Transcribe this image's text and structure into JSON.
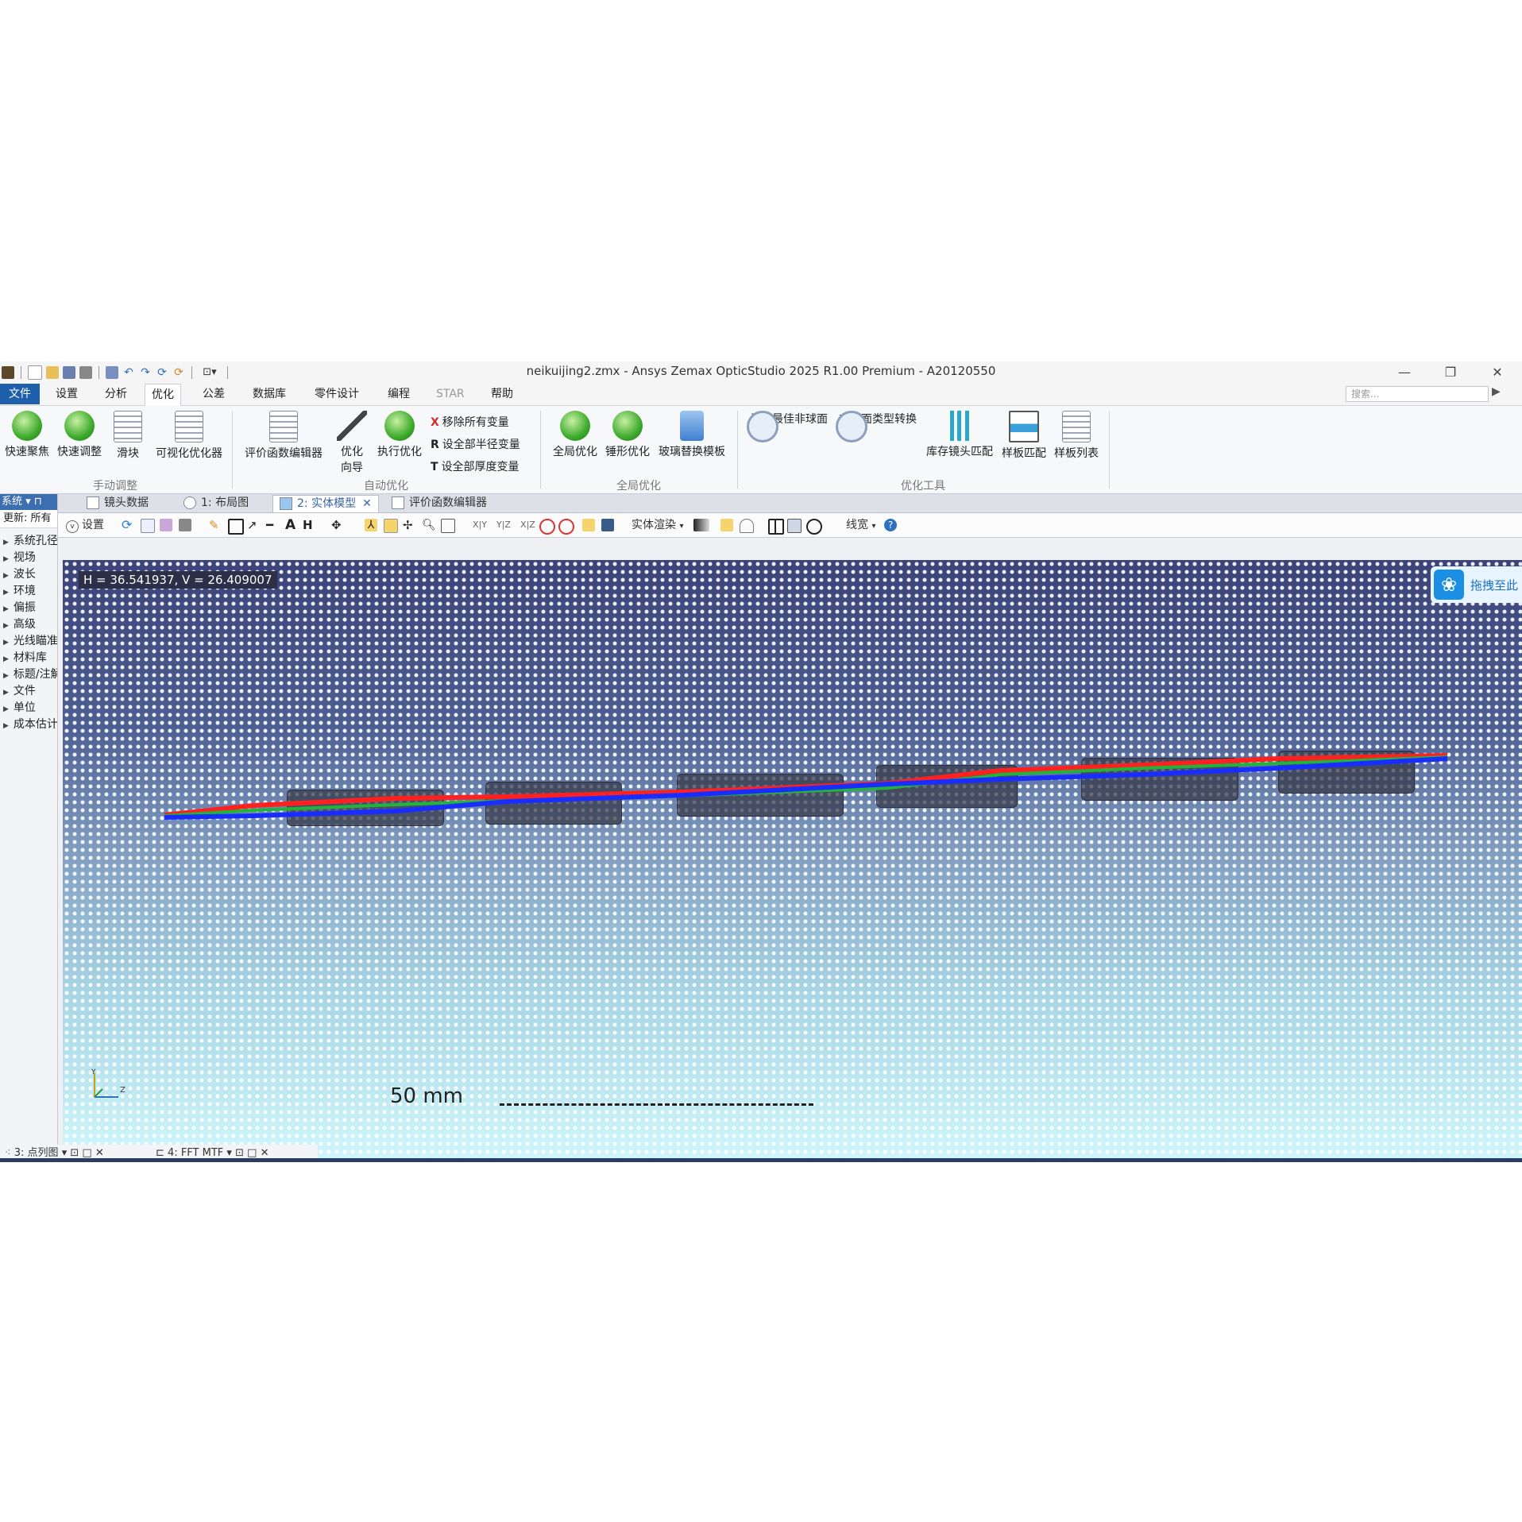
{
  "window": {
    "title": "neikuijing2.zmx - Ansys Zemax OpticStudio 2025 R1.00   Premium - A20120550",
    "minimize": "—",
    "restore": "❐",
    "close": "✕"
  },
  "menu": {
    "items": [
      "文件",
      "设置",
      "分析",
      "优化",
      "公差",
      "数据库",
      "零件设计",
      "编程",
      "STAR",
      "帮助"
    ],
    "active": "优化",
    "search_placeholder": "搜索..."
  },
  "ribbon": {
    "manual": {
      "group": "手动调整",
      "buttons": [
        "快速聚焦",
        "快速调整",
        "滑块",
        "可视化优化器"
      ]
    },
    "auto": {
      "group": "自动优化",
      "buttons": [
        "评价函数编辑器",
        "优化向导",
        "执行优化"
      ],
      "wizard_line1": "优化",
      "wizard_line2": "向导",
      "small": [
        {
          "sym": "X",
          "label": "移除所有变量"
        },
        {
          "sym": "R",
          "label": "设全部半径变量"
        },
        {
          "sym": "T",
          "label": "设全部厚度变量"
        }
      ]
    },
    "global": {
      "group": "全局优化",
      "buttons": [
        "全局优化",
        "锤形优化",
        "玻璃替换模板"
      ]
    },
    "tools": {
      "group": "优化工具",
      "buttons": [
        "寻找最佳非球面",
        "非球面类型转换",
        "库存镜头匹配",
        "样板匹配",
        "样板列表"
      ]
    }
  },
  "left_panel": {
    "header": "系统 ▾ ⊓",
    "update": "更新: 所有",
    "items": [
      "系统孔径",
      "视场",
      "波长",
      "环境",
      "偏振",
      "高级",
      "光线瞄准",
      "材料库",
      "标题/注解",
      "文件",
      "单位",
      "成本估计"
    ]
  },
  "tabs": [
    "镜头数据",
    "1: 布局图",
    "2: 实体模型",
    "评价函数编辑器"
  ],
  "active_tab": "2: 实体模型",
  "graph_toolbar": {
    "settings": "设置",
    "xy": "X|Y",
    "yz": "Y|Z",
    "xz": "X|Z",
    "render": "实体渲染",
    "linewidth": "线宽"
  },
  "graph": {
    "coords": "H = 36.541937, V = 26.409007",
    "badge": "拖拽至此",
    "scale": "50 mm",
    "axis_y": "Y",
    "axis_z": "Z",
    "ray_colors": {
      "red": "#ff2020",
      "green": "#22b43a",
      "blue": "#1a2dff"
    },
    "background": {
      "top": "#3b4378",
      "bottom": "#cff6fb"
    }
  },
  "bottom_tabs": [
    "3: 点列图",
    "4: FFT MTF"
  ]
}
